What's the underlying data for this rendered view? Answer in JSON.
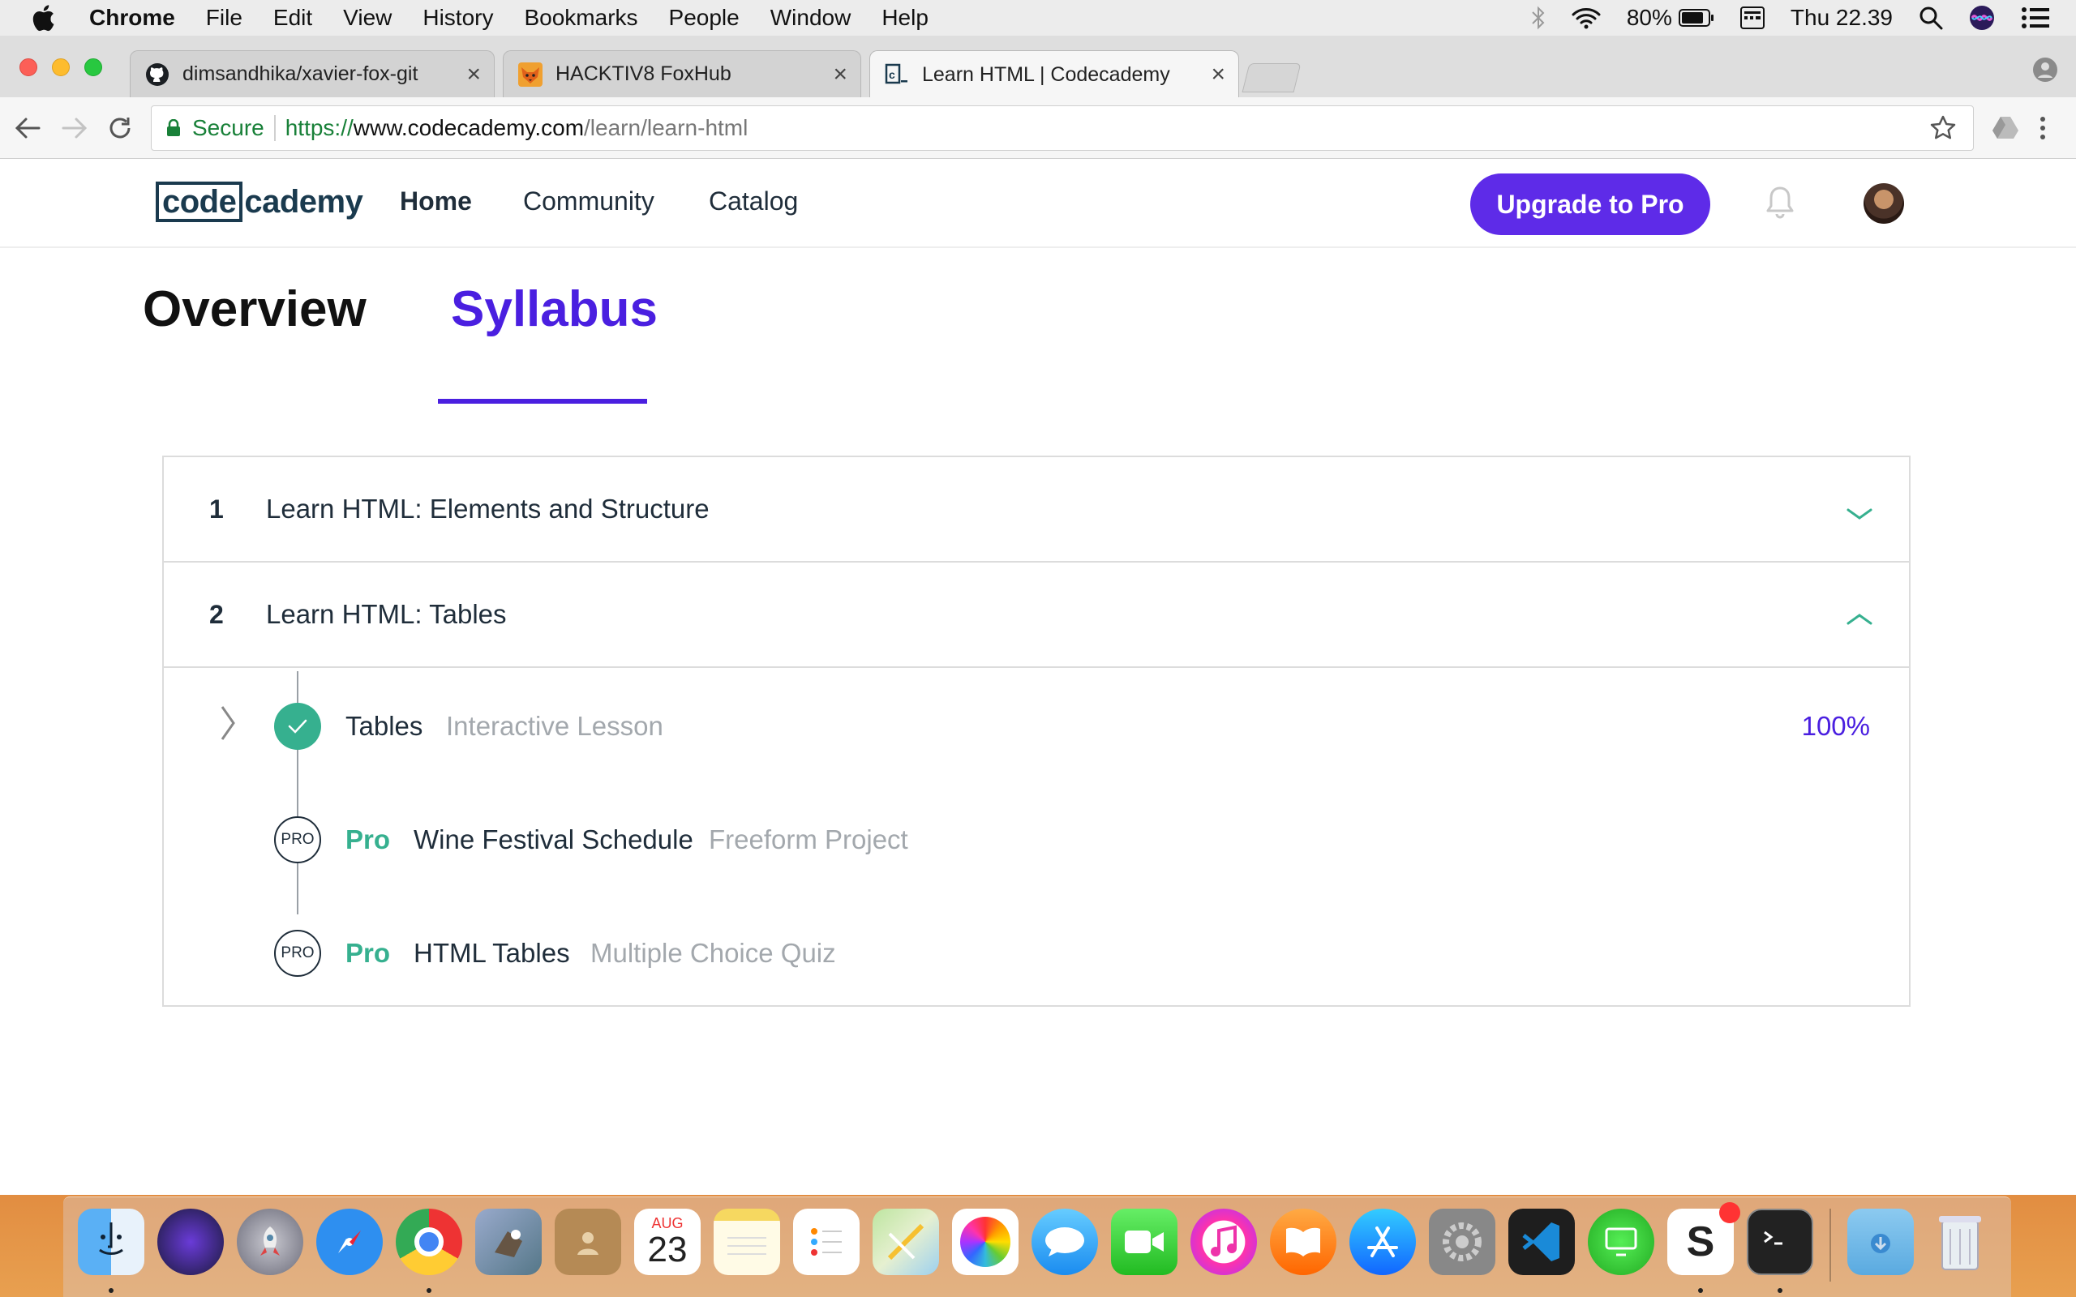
{
  "menubar": {
    "app": "Chrome",
    "items": [
      "File",
      "Edit",
      "View",
      "History",
      "Bookmarks",
      "People",
      "Window",
      "Help"
    ],
    "battery": "80%",
    "clock": "Thu 22.39"
  },
  "browser": {
    "tabs": [
      {
        "title": "dimsandhika/xavier-fox-git",
        "icon": "github-icon"
      },
      {
        "title": "HACKTIV8 FoxHub",
        "icon": "fox-icon"
      },
      {
        "title": "Learn HTML | Codecademy",
        "icon": "codecademy-icon"
      }
    ],
    "secure_label": "Secure",
    "url_scheme": "https://",
    "url_host": "www.codecademy.com",
    "url_path": "/learn/learn-html"
  },
  "site": {
    "logo_boxed": "code",
    "logo_rest": "cademy",
    "nav": [
      "Home",
      "Community",
      "Catalog"
    ],
    "upgrade_label": "Upgrade to Pro"
  },
  "page_tabs": [
    "Overview",
    "Syllabus"
  ],
  "syllabus": {
    "units": [
      {
        "num": "1",
        "title": "Learn HTML: Elements and Structure",
        "expanded": false
      },
      {
        "num": "2",
        "title": "Learn HTML: Tables",
        "expanded": true
      }
    ],
    "lessons": [
      {
        "title": "Tables",
        "type": "Interactive Lesson",
        "pro": false,
        "progress": "100%"
      },
      {
        "title": "Wine Festival Schedule",
        "type": "Freeform Project",
        "pro": true,
        "pro_label": "Pro",
        "badge": "PRO"
      },
      {
        "title": "HTML Tables",
        "type": "Multiple Choice Quiz",
        "pro": true,
        "pro_label": "Pro",
        "badge": "PRO"
      }
    ]
  },
  "dock": {
    "apps": [
      "finder-icon",
      "siri-icon",
      "launchpad-icon",
      "safari-icon",
      "chrome-icon",
      "mail-icon",
      "contacts-icon",
      "calendar-icon",
      "notes-icon",
      "reminders-icon",
      "maps-icon",
      "photos-icon",
      "messages-icon",
      "facetime-icon",
      "itunes-icon",
      "ibooks-icon",
      "appstore-icon",
      "system-preferences-icon",
      "vscode-icon",
      "screen-sharing-icon",
      "sublime-icon",
      "terminal-icon",
      "downloads-icon",
      "trash-icon"
    ],
    "calendar_month": "AUG",
    "calendar_day": "23"
  }
}
